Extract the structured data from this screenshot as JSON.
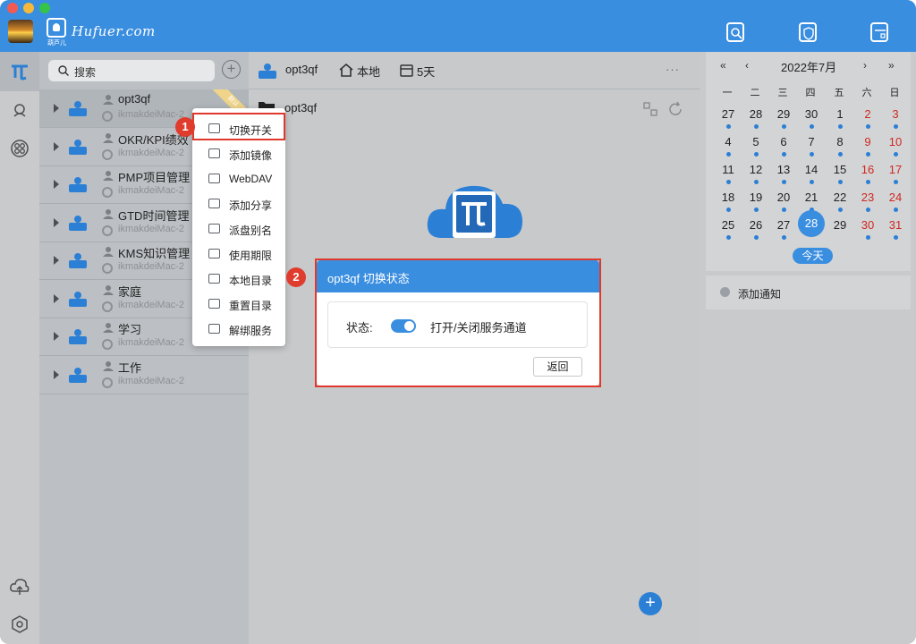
{
  "app": {
    "logo_text": "Hufuer.com",
    "logo_sub": "葫芦儿"
  },
  "sidebar": {
    "search_placeholder": "搜索",
    "add_label": "+",
    "items": [
      {
        "name": "opt3qf",
        "host": "ikmakdeiMac-2",
        "ribbon": "默认"
      },
      {
        "name": "OKR/KPI绩效",
        "host": "ikmakdeiMac-2"
      },
      {
        "name": "PMP项目管理",
        "host": "ikmakdeiMac-2"
      },
      {
        "name": "GTD时间管理",
        "host": "ikmakdeiMac-2"
      },
      {
        "name": "KMS知识管理",
        "host": "ikmakdeiMac-2"
      },
      {
        "name": "家庭",
        "host": "ikmakdeiMac-2"
      },
      {
        "name": "学习",
        "host": "ikmakdeiMac-2"
      },
      {
        "name": "工作",
        "host": "ikmakdeiMac-2"
      }
    ]
  },
  "context_menu": {
    "items": [
      {
        "label": "切换开关",
        "icon": "toggle-icon"
      },
      {
        "label": "添加镜像",
        "icon": "database-icon"
      },
      {
        "label": "WebDAV",
        "icon": "user-icon"
      },
      {
        "label": "添加分享",
        "icon": "share-icon"
      },
      {
        "label": "派盘别名",
        "icon": "drive-icon"
      },
      {
        "label": "使用期限",
        "icon": "calendar-icon"
      },
      {
        "label": "本地目录",
        "icon": "monitor-icon"
      },
      {
        "label": "重置目录",
        "icon": "reset-icon"
      },
      {
        "label": "解绑服务",
        "icon": "unlink-icon"
      }
    ]
  },
  "callouts": {
    "one": "1",
    "two": "2"
  },
  "main": {
    "drive_name": "opt3qf",
    "location": "本地",
    "duration": "5天",
    "more": "···",
    "path": "opt3qf",
    "fab": "+"
  },
  "dialog": {
    "title": "opt3qf 切换状态",
    "status_label": "状态:",
    "toggle_on": true,
    "toggle_desc": "打开/关闭服务通道",
    "back_label": "返回"
  },
  "calendar": {
    "title": "2022年7月",
    "nav": {
      "prev_year": "«",
      "prev_month": "‹",
      "next_month": "›",
      "next_year": "»"
    },
    "weekdays": [
      "一",
      "二",
      "三",
      "四",
      "五",
      "六",
      "日"
    ],
    "weeks": [
      [
        "27",
        "28",
        "29",
        "30",
        "1",
        "2",
        "3"
      ],
      [
        "4",
        "5",
        "6",
        "7",
        "8",
        "9",
        "10"
      ],
      [
        "11",
        "12",
        "13",
        "14",
        "15",
        "16",
        "17"
      ],
      [
        "18",
        "19",
        "20",
        "21",
        "22",
        "23",
        "24"
      ],
      [
        "25",
        "26",
        "27",
        "28",
        "29",
        "30",
        "31"
      ]
    ],
    "selected_day": "28",
    "today_label": "今天",
    "weekend_color": "#d0281f",
    "accent": "#3a8ee0"
  },
  "notice": {
    "label": "添加通知"
  }
}
